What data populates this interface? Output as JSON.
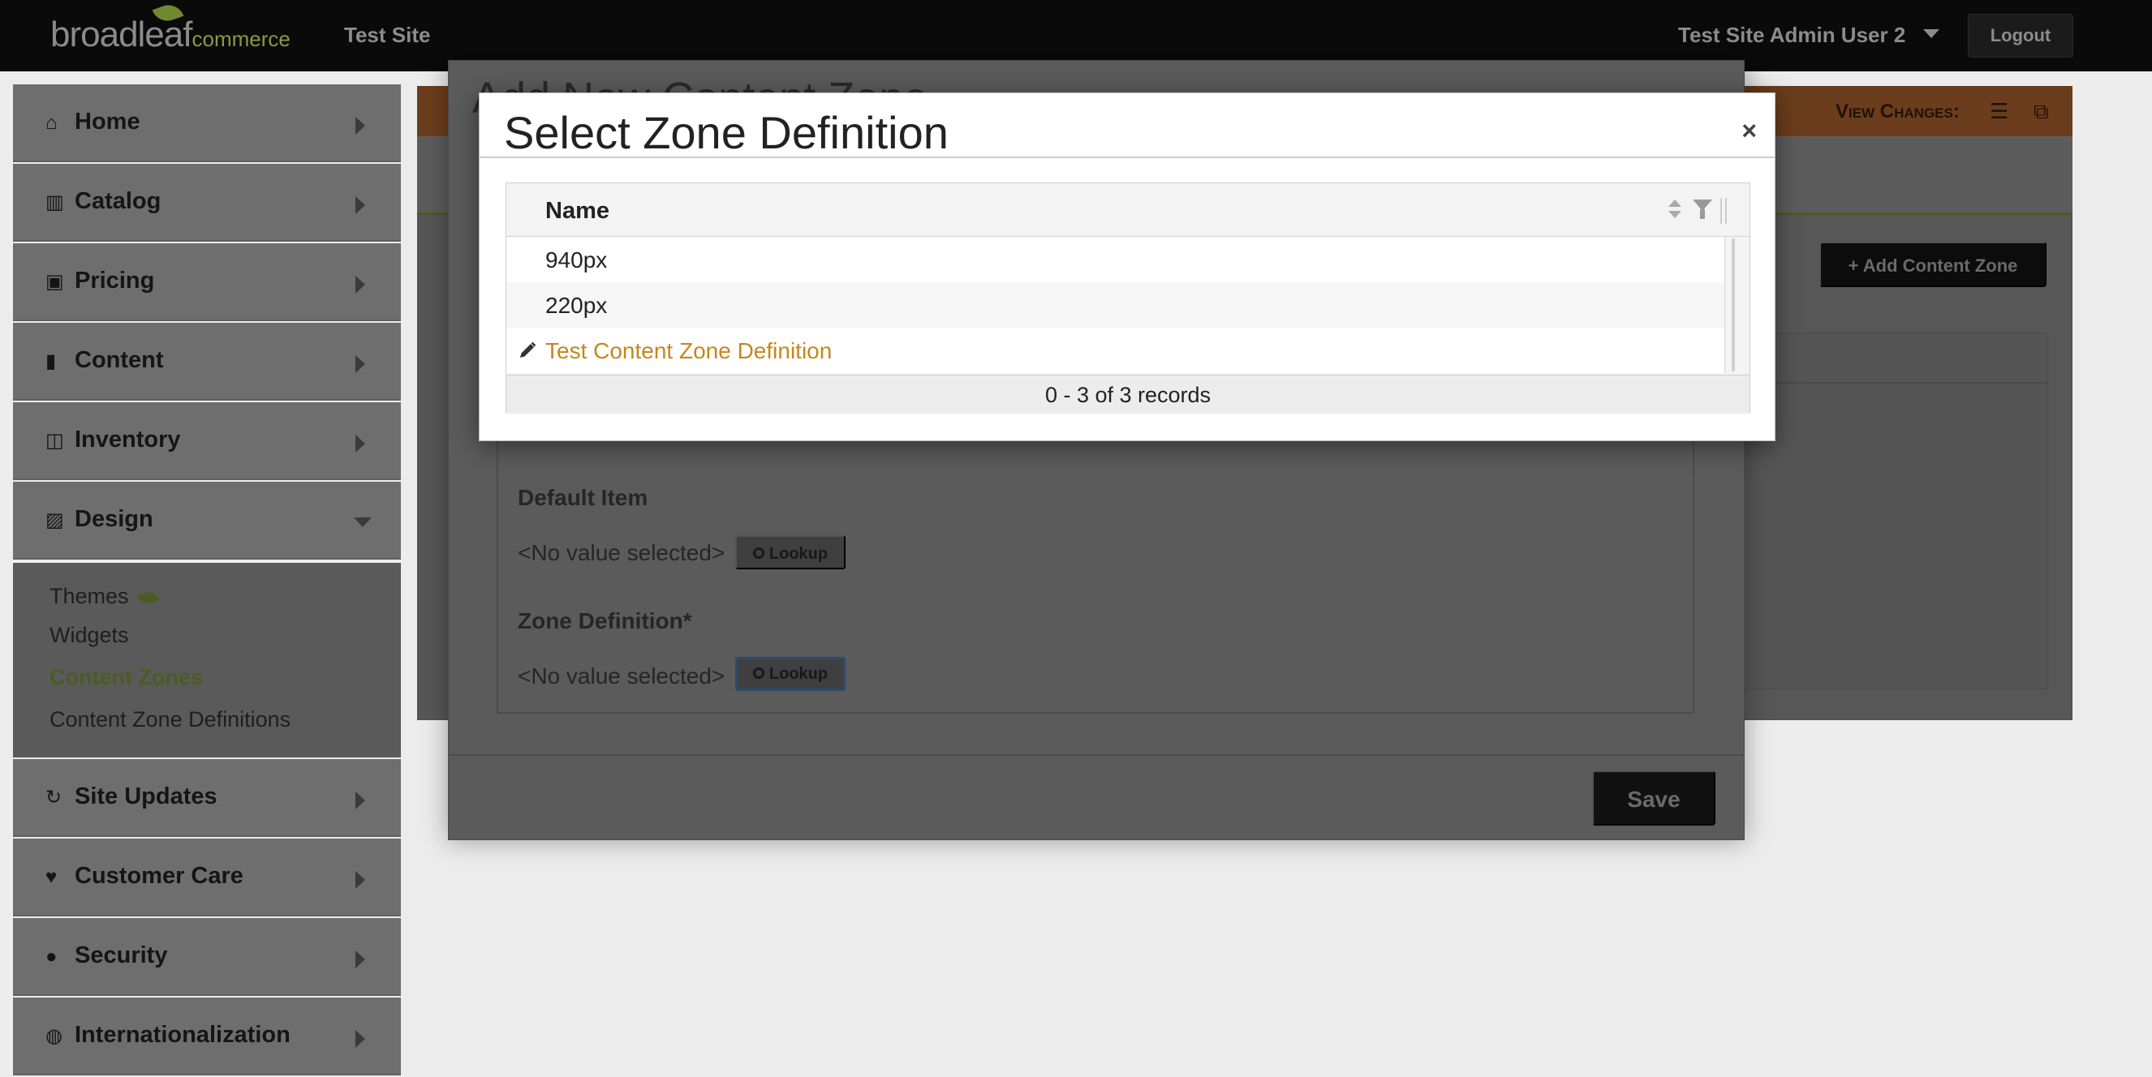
{
  "topbar": {
    "logo_main": "broadleaf",
    "logo_sub": "commerce",
    "site_name": "Test Site",
    "admin_user": "Test Site Admin User 2",
    "logout_label": "Logout"
  },
  "sidebar": {
    "items": [
      {
        "label": "Home",
        "icon": "home-icon"
      },
      {
        "label": "Catalog",
        "icon": "barcode-icon"
      },
      {
        "label": "Pricing",
        "icon": "money-icon"
      },
      {
        "label": "Content",
        "icon": "file-icon"
      },
      {
        "label": "Inventory",
        "icon": "inbox-icon"
      },
      {
        "label": "Design",
        "icon": "picture-icon"
      },
      {
        "label": "Site Updates",
        "icon": "refresh-icon"
      },
      {
        "label": "Customer Care",
        "icon": "heart-icon"
      },
      {
        "label": "Security",
        "icon": "user-icon"
      },
      {
        "label": "Internationalization",
        "icon": "globe-icon"
      }
    ],
    "design_subitems": [
      {
        "label": "Themes"
      },
      {
        "label": "Widgets"
      },
      {
        "label": "Content Zones",
        "active": true
      },
      {
        "label": "Content Zone Definitions"
      }
    ]
  },
  "background": {
    "view_changes_label": "View Changes:",
    "add_content_zone_label": "Add Content Zone"
  },
  "back_modal": {
    "title": "Add New Content Zone",
    "default_item_label": "Default Item",
    "default_item_value": "<No value selected>",
    "zone_definition_label": "Zone Definition*",
    "zone_definition_value": "<No value selected>",
    "lookup_label": "Lookup",
    "save_label": "Save"
  },
  "modal": {
    "title": "Select Zone Definition",
    "close_label": "×",
    "grid": {
      "column_name": "Name",
      "rows": [
        "940px",
        "220px",
        "Test Content Zone Definition"
      ],
      "records_text": "0 - 3 of 3 records"
    }
  },
  "colors": {
    "accent_link": "#c7861a",
    "active_nav": "#4e5a21",
    "topbar_bg": "#0a0a0a"
  }
}
